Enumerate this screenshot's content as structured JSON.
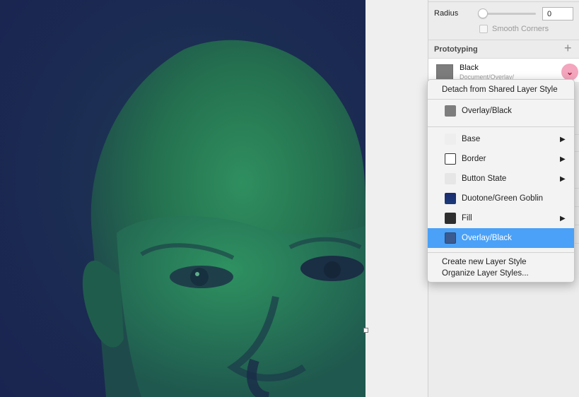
{
  "inspector": {
    "radius_label": "Radius",
    "radius_value": "0",
    "smooth_corners_label": "Smooth Corners",
    "prototyping_title": "Prototyping",
    "shared_style": {
      "name": "Black",
      "path": "Document/Overlay/"
    }
  },
  "menu": {
    "detach_label": "Detach from Shared Layer Style",
    "current_style": "Overlay/Black",
    "items": [
      {
        "label": "Base",
        "swatch": "#eeeeee",
        "has_submenu": true
      },
      {
        "label": "Border",
        "swatch": "#ffffff",
        "has_submenu": true
      },
      {
        "label": "Button State",
        "swatch": "#e8e8e8",
        "has_submenu": true
      },
      {
        "label": "Duotone/Green Goblin",
        "swatch": "#1a2a6e",
        "has_submenu": false
      },
      {
        "label": "Fill",
        "swatch": "#2e2e2e",
        "has_submenu": true
      },
      {
        "label": "Overlay/Black",
        "swatch": "#3a5a90",
        "has_submenu": false,
        "selected": true
      }
    ],
    "create_label": "Create new Layer Style",
    "organize_label": "Organize Layer Styles..."
  },
  "colors": {
    "accent": "#4aa1f7",
    "duotone_dark": "#1b2b52",
    "duotone_light": "#2b8a5a",
    "chevron_bg": "#f3a6bd"
  }
}
